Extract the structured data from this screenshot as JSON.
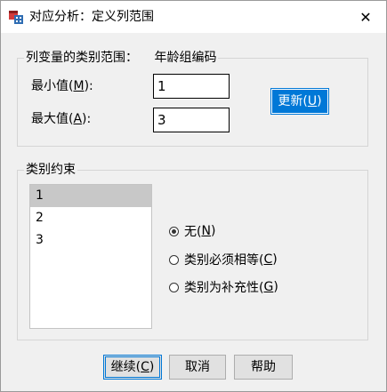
{
  "window": {
    "title": "对应分析：定义列范围",
    "close_glyph": "✕"
  },
  "range_group": {
    "title": "列变量的类别范围：",
    "variable": "年龄组编码",
    "min_label": "最小值(",
    "min_key": "M",
    "min_suffix": "):",
    "min_value": "1",
    "max_label": "最大值(",
    "max_key": "A",
    "max_suffix": "):",
    "max_value": "3",
    "update_label": "更新(",
    "update_key": "U",
    "update_suffix": ")"
  },
  "constraint_group": {
    "title": "类别约束",
    "categories": [
      "1",
      "2",
      "3"
    ],
    "selected_index": 0,
    "options": [
      {
        "label": "无(",
        "key": "N",
        "suffix": ")",
        "checked": true
      },
      {
        "label": "类别必须相等(",
        "key": "C",
        "suffix": ")",
        "checked": false
      },
      {
        "label": "类别为补充性(",
        "key": "G",
        "suffix": ")",
        "checked": false
      }
    ]
  },
  "footer": {
    "continue_label": "继续(",
    "continue_key": "C",
    "continue_suffix": ")",
    "cancel_label": "取消",
    "help_label": "帮助"
  },
  "colors": {
    "accent": "#0078d7",
    "selected_row": "#c8c8c8"
  }
}
